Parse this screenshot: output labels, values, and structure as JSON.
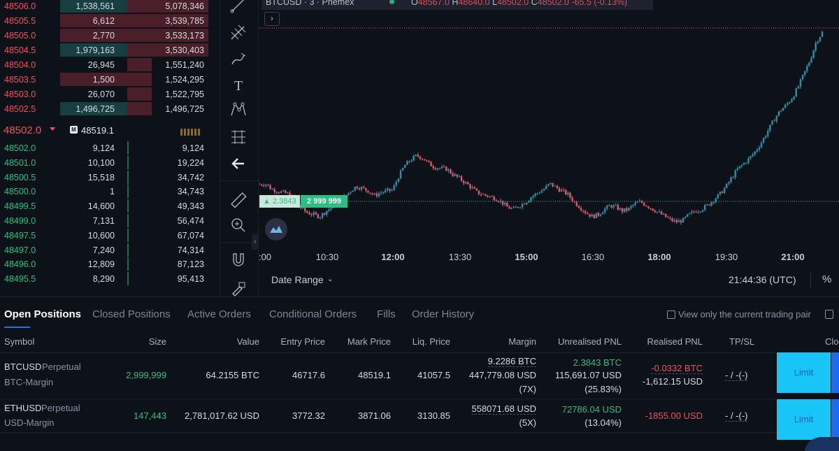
{
  "orderbook": {
    "asks": [
      {
        "price": "48506.0",
        "size": "1,538,561",
        "total": "5,078,346",
        "size_bar": 1.0,
        "total_bar": 1.0
      },
      {
        "price": "48505.5",
        "size": "6,612",
        "total": "3,539,785",
        "size_bar": 1.0,
        "total_bar": 1.0
      },
      {
        "price": "48505.0",
        "size": "2,770",
        "total": "3,533,173",
        "size_bar": 1.0,
        "total_bar": 1.0
      },
      {
        "price": "48504.5",
        "size": "1,979,163",
        "total": "3,530,403",
        "size_bar": 1.0,
        "total_bar": 1.0
      },
      {
        "price": "48504.0",
        "size": "26,945",
        "total": "1,551,240",
        "size_bar": 0,
        "total_bar": 0.3
      },
      {
        "price": "48503.5",
        "size": "1,500",
        "total": "1,524,295",
        "size_bar": 1.0,
        "total_bar": 0.3
      },
      {
        "price": "48503.0",
        "size": "26,070",
        "total": "1,522,795",
        "size_bar": 0,
        "total_bar": 0.3
      },
      {
        "price": "48502.5",
        "size": "1,496,725",
        "total": "1,496,725",
        "size_bar": 1.0,
        "total_bar": 0.3
      }
    ],
    "mid": {
      "last_price": "48502.0",
      "mark_label": "M",
      "mark_price": "48519.1"
    },
    "bids": [
      {
        "price": "48502.0",
        "size": "9,124",
        "total": "9,124"
      },
      {
        "price": "48501.0",
        "size": "10,100",
        "total": "19,224"
      },
      {
        "price": "48500.5",
        "size": "15,518",
        "total": "34,742"
      },
      {
        "price": "48500.0",
        "size": "1",
        "total": "34,743"
      },
      {
        "price": "48499.5",
        "size": "14,600",
        "total": "49,343"
      },
      {
        "price": "48499.0",
        "size": "7,131",
        "total": "56,474"
      },
      {
        "price": "48497.5",
        "size": "10,600",
        "total": "67,074"
      },
      {
        "price": "48497.0",
        "size": "7,240",
        "total": "74,314"
      },
      {
        "price": "48496.0",
        "size": "12,809",
        "total": "87,123"
      },
      {
        "price": "48495.5",
        "size": "8,290",
        "total": "95,413"
      }
    ],
    "colors": {
      "ask": "#f0515f",
      "bid": "#2ebd85"
    }
  },
  "toolbar": {
    "tools": [
      "trend-line-icon",
      "fib-icon",
      "brush-icon",
      "text-icon",
      "pattern-icon",
      "projection-icon",
      "back-arrow-icon",
      "ruler-icon",
      "zoom-in-icon",
      "magnet-icon",
      "lock-draw-icon"
    ],
    "text_tool_glyph": "T",
    "collapse_glyph": "‹"
  },
  "chart": {
    "legend": {
      "symbol": "BTCUSD · 3 · Phemex",
      "o_label": "O",
      "o": "48567.0",
      "h_label": "H",
      "h": "48640.0",
      "l_label": "L",
      "l": "48502.0",
      "c_label": "C",
      "c": "48502.0",
      "change": "-65.5 (-0.13%)"
    },
    "expand_glyph": "›",
    "position_label": {
      "pnl": "▲ 2.3843",
      "qty": "2 999 999"
    },
    "x_labels": [
      ":00",
      "10:30",
      "12:00",
      "13:30",
      "15:00",
      "16:30",
      "18:00",
      "19:30",
      "21:00"
    ],
    "footer": {
      "date_range": "Date Range",
      "caret": "⌄",
      "clock": "21:44:36 (UTC)",
      "percent": "%"
    }
  },
  "chart_data": {
    "type": "candlestick",
    "symbol": "BTCUSD",
    "interval": "3",
    "exchange": "Phemex",
    "x_ticks": [
      "10:30",
      "12:00",
      "13:30",
      "15:00",
      "16:30",
      "18:00",
      "19:30",
      "21:00"
    ],
    "close_path": [
      46830,
      46840,
      46780,
      46760,
      46740,
      46720,
      46650,
      46560,
      46520,
      46500,
      46480,
      46540,
      46580,
      46640,
      46690,
      46760,
      46810,
      46790,
      46760,
      46710,
      46740,
      46760,
      46770,
      46920,
      47040,
      47100,
      47150,
      47120,
      47060,
      47020,
      47010,
      47000,
      46940,
      46900,
      46850,
      46800,
      46740,
      46720,
      46700,
      46680,
      46640,
      46580,
      46560,
      46600,
      46640,
      46700,
      46740,
      46780,
      46840,
      46800,
      46760,
      46720,
      46640,
      46580,
      46520,
      46480,
      46500,
      46560,
      46600,
      46580,
      46540,
      46560,
      46620,
      46640,
      46600,
      46560,
      46520,
      46480,
      46440,
      46420,
      46440,
      46500,
      46540,
      46560,
      46600,
      46660,
      46720,
      46800,
      46900,
      47000,
      47060,
      47120,
      47200,
      47300,
      47420,
      47540,
      47640,
      47700,
      47780,
      47900,
      48050,
      48200,
      48400,
      48500
    ],
    "last_close": 48502.0,
    "position_entry_line": "2 999 999"
  },
  "positions": {
    "tabs": [
      "Open Positions",
      "Closed Positions",
      "Active Orders",
      "Conditional Orders",
      "Fills",
      "Order History"
    ],
    "current_pair_label": "View only the current trading pair",
    "headers": {
      "symbol": "Symbol",
      "size": "Size",
      "value": "Value",
      "entry": "Entry Price",
      "mark": "Mark Price",
      "liq": "Liq. Price",
      "margin": "Margin",
      "upnl": "Unrealised PNL",
      "rpnl": "Realised PNL",
      "tpsl": "TP/SL",
      "close": "Clo"
    },
    "rows": [
      {
        "symbol": "BTCUSD",
        "type": "Perpetual",
        "margin_type": "BTC-Margin",
        "size": "2,999,999",
        "value": "64.2155 BTC",
        "entry": "46717.6",
        "mark": "48519.1",
        "liq": "41057.5",
        "margin_1": "9.2286 BTC",
        "margin_2": "447,779.08 USD",
        "margin_3": "(7X)",
        "upnl_1": "2.3843 BTC",
        "upnl_2": "115,691.07 USD",
        "upnl_3": "(25.83%)",
        "rpnl_1": "-0.0332 BTC",
        "rpnl_2": "-1,612.15 USD",
        "tpsl": "- / -(-)",
        "action": "Limit"
      },
      {
        "symbol": "ETHUSD",
        "type": "Perpetual",
        "margin_type": "USD-Margin",
        "size": "147,443",
        "value": "2,781,017.62 USD",
        "entry": "3772.32",
        "mark": "3871.06",
        "liq": "3130.85",
        "margin_1": "558071.68 USD",
        "margin_2": "(5X)",
        "upnl_1": "72786.04 USD",
        "upnl_2": "(13.04%)",
        "rpnl_1": "-1855.00 USD",
        "tpsl": "- / -(-)",
        "action": "Limit"
      }
    ]
  }
}
